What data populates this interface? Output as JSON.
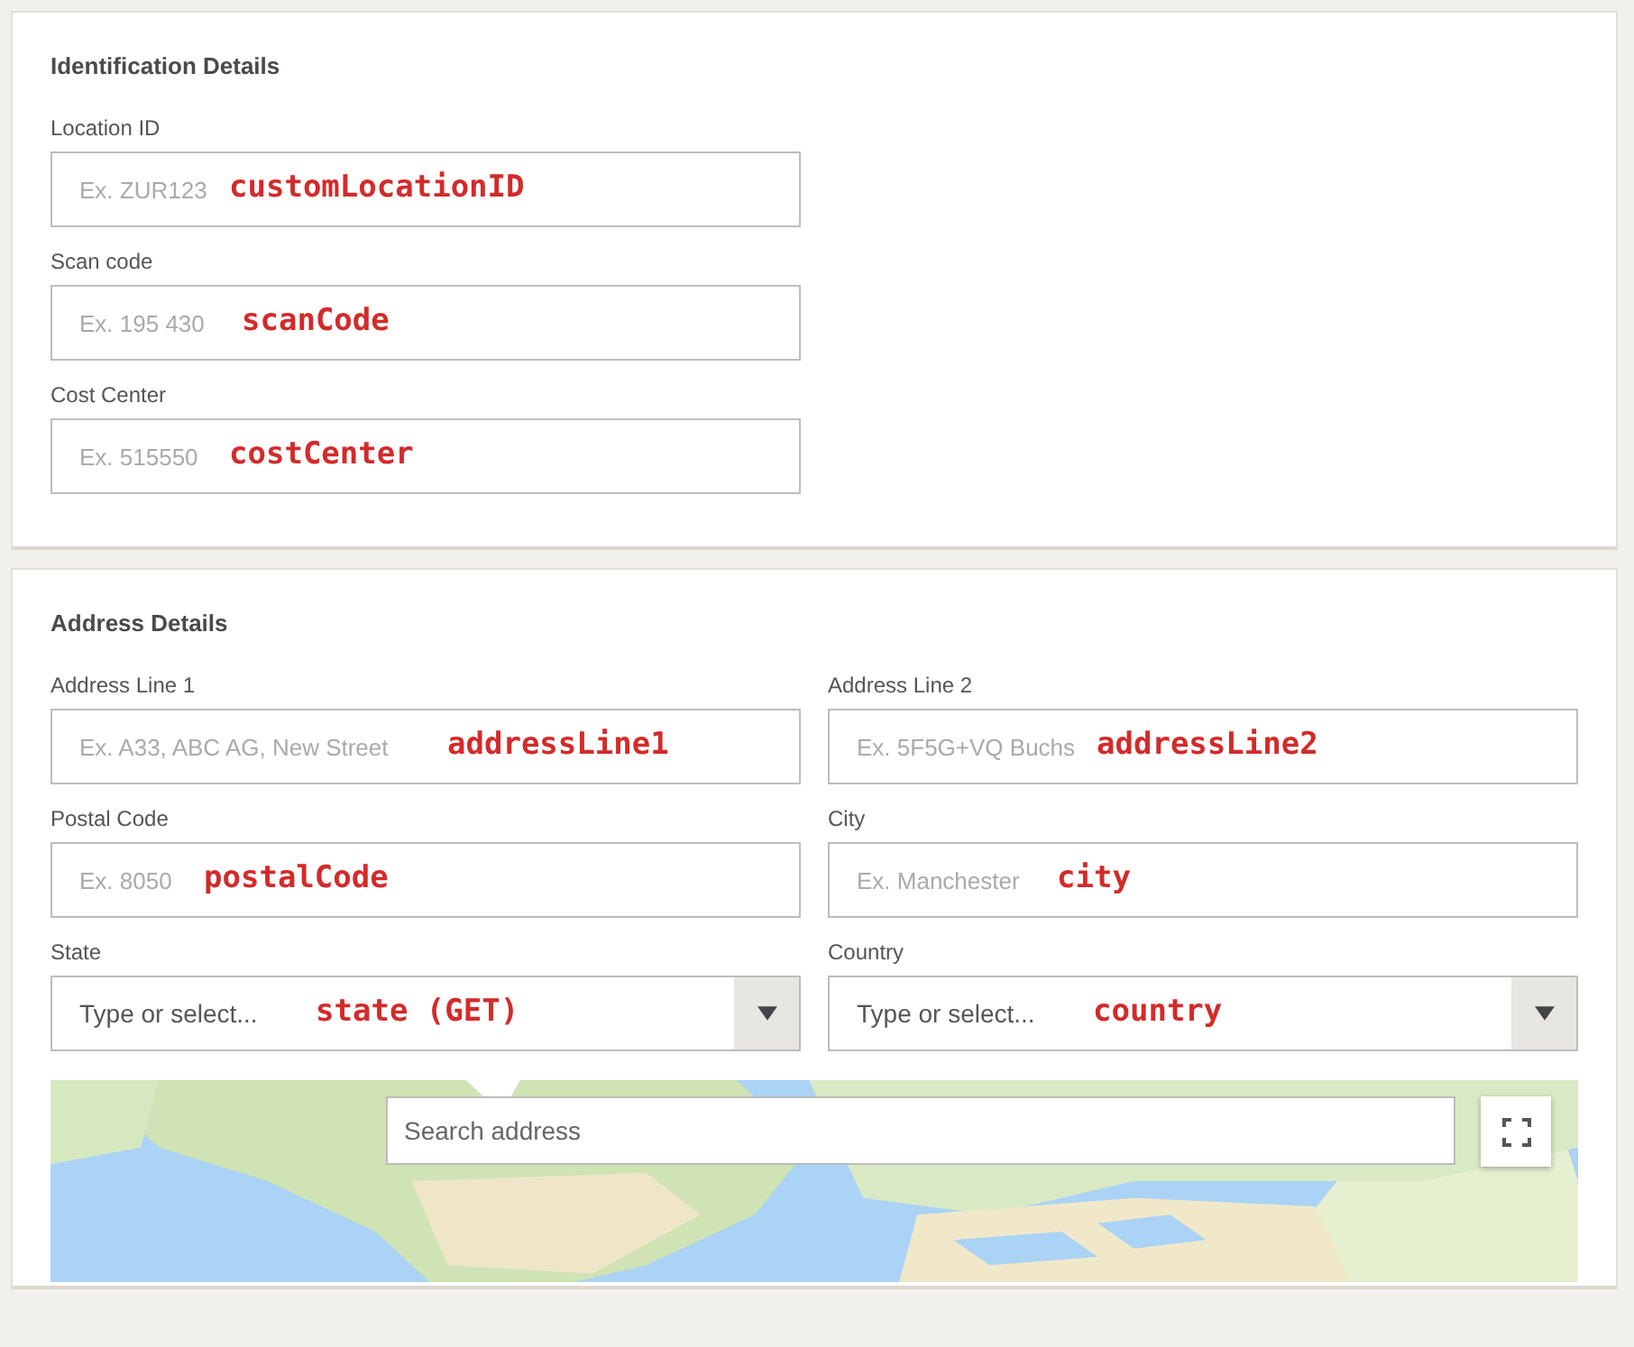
{
  "sections": [
    {
      "title": "Identification Details",
      "fields": [
        {
          "kind": "text",
          "label": "Location ID",
          "placeholder": "Ex. ZUR123",
          "annotation": "customLocationID"
        },
        {
          "kind": "text",
          "label": "Scan code",
          "placeholder": "Ex. 195 430",
          "annotation": "scanCode"
        },
        {
          "kind": "text",
          "label": "Cost Center",
          "placeholder": "Ex. 515550",
          "annotation": "costCenter"
        }
      ]
    },
    {
      "title": "Address Details",
      "fields": [
        {
          "kind": "text",
          "label": "Address Line 1",
          "placeholder": "Ex. A33, ABC AG, New Street",
          "annotation": "addressLine1"
        },
        {
          "kind": "text",
          "label": "Address Line 2",
          "placeholder": "Ex. 5F5G+VQ Buchs",
          "annotation": "addressLine2"
        },
        {
          "kind": "text",
          "label": "Postal Code",
          "placeholder": "Ex. 8050",
          "annotation": "postalCode"
        },
        {
          "kind": "text",
          "label": "City",
          "placeholder": "Ex. Manchester",
          "annotation": "city"
        },
        {
          "kind": "select",
          "label": "State",
          "placeholder": "Type or select...",
          "annotation": "state (GET)"
        },
        {
          "kind": "select",
          "label": "Country",
          "placeholder": "Type or select...",
          "annotation": "country"
        }
      ],
      "map": {
        "kind": "picture",
        "search": {
          "placeholder": "Search address"
        }
      }
    }
  ]
}
